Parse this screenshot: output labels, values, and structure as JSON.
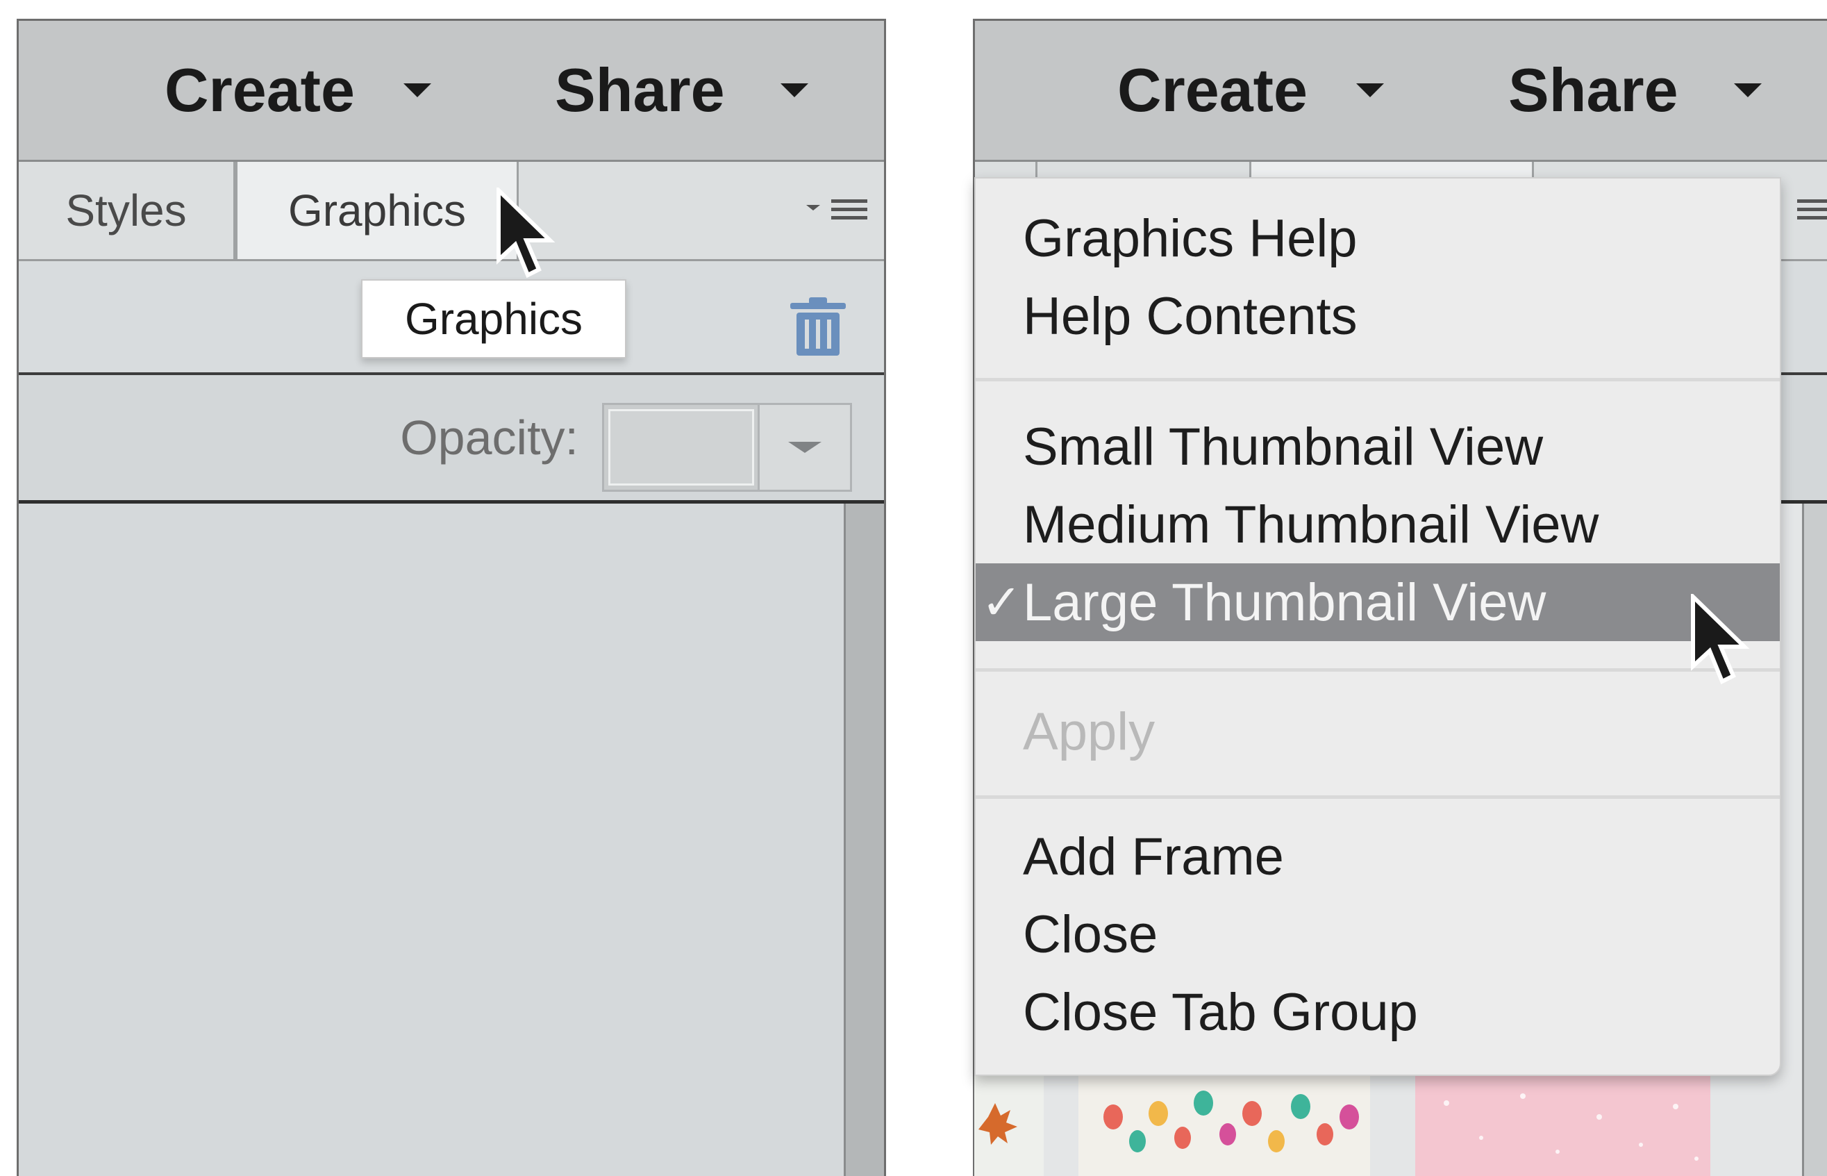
{
  "left_panel": {
    "create_label": "Create",
    "share_label": "Share",
    "tabs": [
      {
        "label": "Styles",
        "active": false
      },
      {
        "label": "Graphics",
        "active": true
      }
    ],
    "tooltip": "Graphics",
    "opacity_label": "Opacity:"
  },
  "right_panel": {
    "create_label": "Create",
    "share_label": "Share",
    "menu": {
      "groups": [
        [
          "Graphics Help",
          "Help Contents"
        ],
        [
          "Small Thumbnail View",
          "Medium Thumbnail View",
          "Large Thumbnail View"
        ],
        [
          "Apply"
        ],
        [
          "Add Frame",
          "Close",
          "Close Tab Group"
        ]
      ],
      "checked_item": "Large Thumbnail View",
      "disabled_item": "Apply",
      "check_glyph": "✓"
    }
  },
  "colors": {
    "topbar": "#c4c6c7",
    "panel": "#d5d9db",
    "menu_bg": "#ececec",
    "menu_selected": "#8a8b8e",
    "trash_icon": "#6a8fbd"
  },
  "icons": [
    "caret-down-icon",
    "panel-menu-icon",
    "trash-icon",
    "pointer-cursor-icon",
    "checkmark-icon"
  ]
}
